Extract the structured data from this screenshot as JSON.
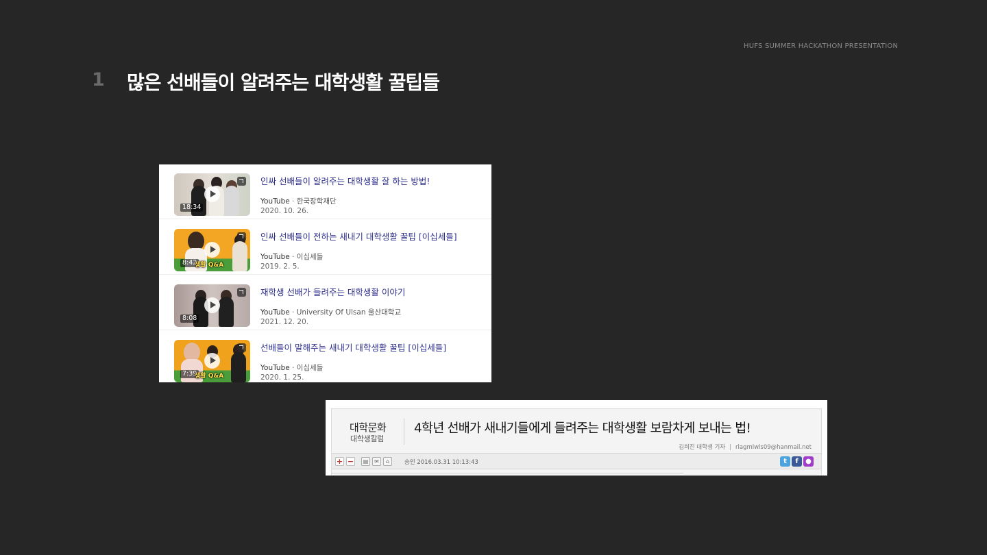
{
  "header": {
    "tag": "HUFS SUMMER HACKATHON PRESENTATION",
    "slide_number": "1",
    "title": "많은 선배들이 알려주는 대학생활 꿀팁들"
  },
  "videos": [
    {
      "title": "인싸 선배들이 알려주는 대학생활 잘 하는 방법!",
      "platform": "YouTube",
      "channel": " · 한국장학재단",
      "date": "2020. 10. 26.",
      "duration": "18:34",
      "thumb_caption": "",
      "thumb_bg": "#d9d3cb",
      "accent": "#e9e4dc"
    },
    {
      "title": "인싸 선배들이 전하는 새내기 대학생활 꿀팁 [이십세들]",
      "platform": "YouTube",
      "channel": " · 이십세들",
      "date": "2019. 2. 5.",
      "duration": "8:42",
      "thumb_caption": "생활 Q&A",
      "thumb_bg": "#f2a623",
      "accent": "#4a9e3a"
    },
    {
      "title": "재학생 선배가 들려주는 대학생활 이야기",
      "platform": "YouTube",
      "channel": " · University Of Ulsan 울산대학교",
      "date": "2021. 12. 20.",
      "duration": "8:08",
      "thumb_caption": "",
      "thumb_bg": "#b8a9a6",
      "accent": "#d8cfcb"
    },
    {
      "title": "선배들이 말해주는 새내기 대학생활 꿀팁 [이십세들]",
      "platform": "YouTube",
      "channel": " · 이십세들",
      "date": "2020. 1. 25.",
      "duration": "7:39",
      "thumb_caption": "생활 Q&A",
      "thumb_bg": "#f0a21c",
      "accent": "#4a9e3a"
    }
  ],
  "article": {
    "section": "대학문화",
    "subsection": "대학생칼럼",
    "title": "4학년 선배가 새내기들에게 들려주는 대학생활 보람차게 보내는 법!",
    "reporter": "김희진 대학생 기자",
    "email": "rlagmlwls09@hanmail.net",
    "approval": "승인 2016.03.31  10:13:43",
    "font_increase": "+",
    "font_decrease": "−"
  }
}
